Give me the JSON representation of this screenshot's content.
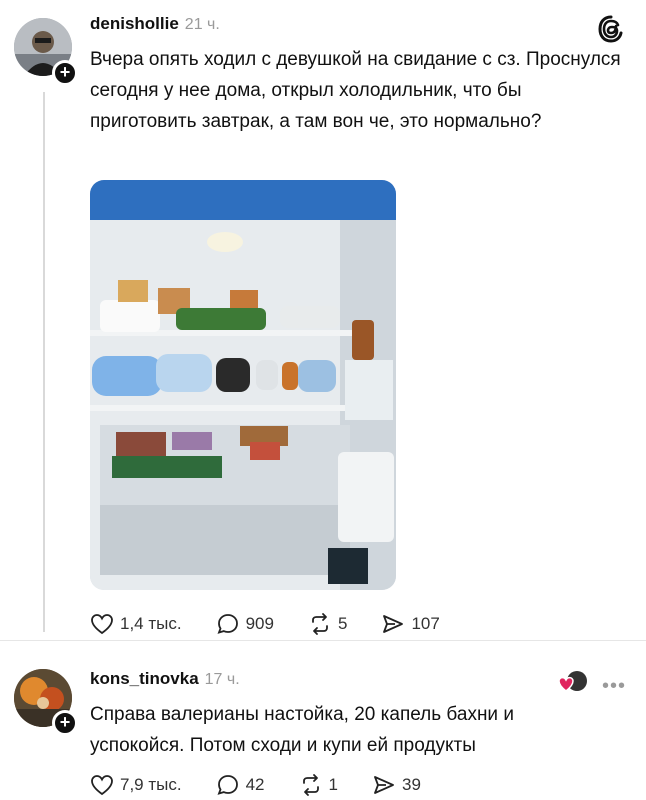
{
  "post1": {
    "username": "denishollie",
    "time": "21 ч.",
    "text": "Вчера опять ходил с девушкой на свидание с сз. Проснулся сегодня у нее дома, открыл холодильник, что бы приготовить завтрак, а там вон че, это нормально?",
    "likes": "1,4 тыс.",
    "comments": "909",
    "reposts": "5",
    "shares": "107"
  },
  "post2": {
    "username": "kons_tinovka",
    "time": "17 ч.",
    "text": "Справа валерианы настойка, 20 капель бахни и успокойся. Потом сходи и купи ей продукты",
    "likes": "7,9 тыс.",
    "comments": "42",
    "reposts": "1",
    "shares": "39"
  },
  "icons": {
    "like": "heart-icon",
    "comment": "speech-bubble-icon",
    "repost": "repost-arrows-icon",
    "share": "send-icon",
    "brand": "threads-logo-icon"
  },
  "colors": {
    "text": "#111111",
    "muted": "#9a9a9a",
    "accent_heart": "#e0245e"
  }
}
